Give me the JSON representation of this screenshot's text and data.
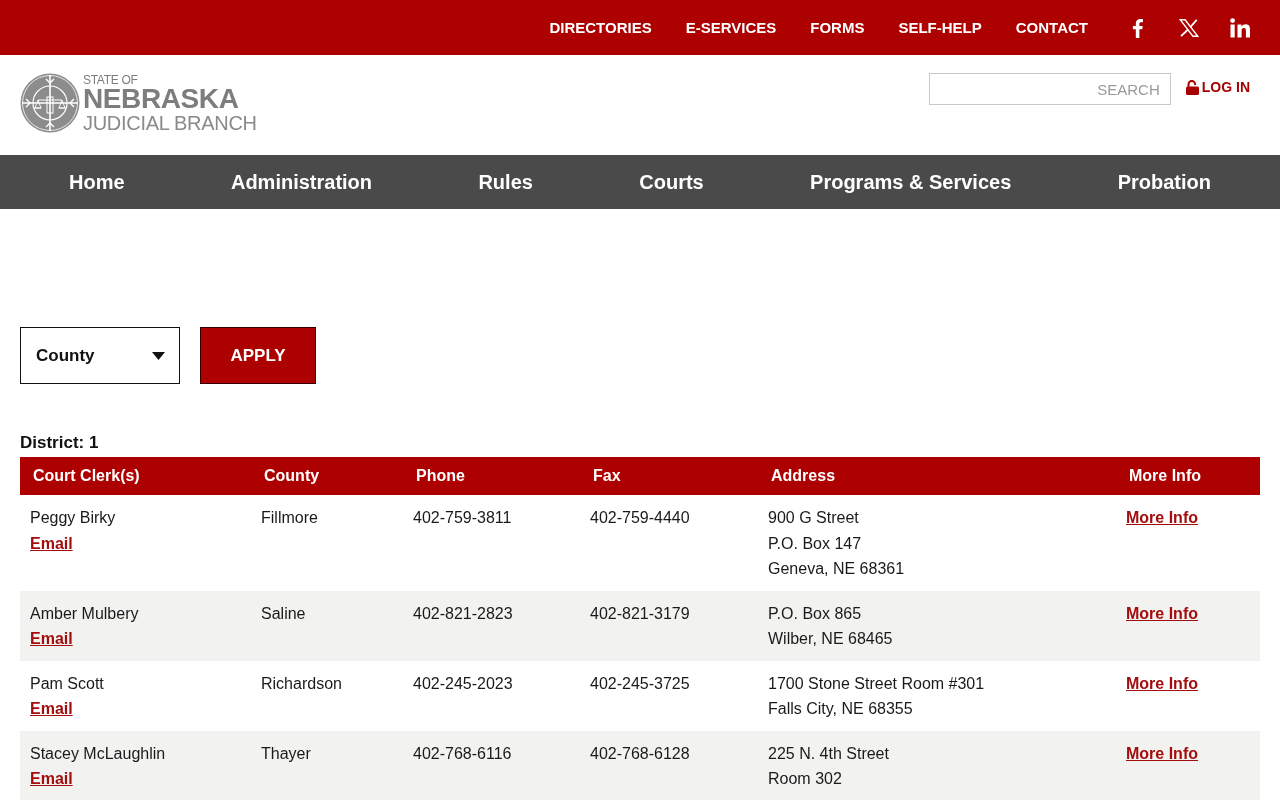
{
  "top_bar": {
    "links": [
      "DIRECTORIES",
      "E-SERVICES",
      "FORMS",
      "SELF-HELP",
      "CONTACT"
    ],
    "social": [
      {
        "kind": "facebook"
      },
      {
        "kind": "x"
      },
      {
        "kind": "linkedin"
      }
    ]
  },
  "header": {
    "logo": {
      "small": "STATE OF",
      "main": "NEBRASKA",
      "sub": "JUDICIAL BRANCH"
    },
    "search": {
      "placeholder": "SEARCH"
    },
    "login": "LOG IN"
  },
  "nav": {
    "items": [
      "Home",
      "Administration",
      "Rules",
      "Courts",
      "Programs & Services",
      "Probation"
    ]
  },
  "filter": {
    "select": {
      "value": "County"
    },
    "button": "APPLY"
  },
  "directory": {
    "heading": "District: 1",
    "table": {
      "columns": [
        "Court Clerk(s)",
        "County",
        "Phone",
        "Fax",
        "Address",
        "More Info"
      ],
      "rows": [
        {
          "clerk": "Peggy Birky",
          "email": "Email",
          "county": "Fillmore",
          "phone": "402-759-3811",
          "fax": "402-759-4440",
          "address": [
            "900 G Street",
            "P.O. Box 147",
            "Geneva, NE 68361"
          ],
          "more_info": "More Info"
        },
        {
          "clerk": "Amber Mulbery",
          "email": "Email",
          "county": "Saline",
          "phone": "402-821-2823",
          "fax": "402-821-3179",
          "address": [
            "P.O. Box 865",
            "Wilber, NE 68465"
          ],
          "more_info": "More Info"
        },
        {
          "clerk": "Pam Scott",
          "email": "Email",
          "county": "Richardson",
          "phone": "402-245-2023",
          "fax": "402-245-3725",
          "address": [
            "1700 Stone Street Room #301",
            "Falls City, NE 68355"
          ],
          "more_info": "More Info"
        },
        {
          "clerk": "Stacey McLaughlin",
          "email": "Email",
          "county": "Thayer",
          "phone": "402-768-6116",
          "fax": "402-768-6128",
          "address": [
            "225 N. 4th Street",
            "Room 302"
          ],
          "more_info": "More Info"
        }
      ]
    }
  }
}
